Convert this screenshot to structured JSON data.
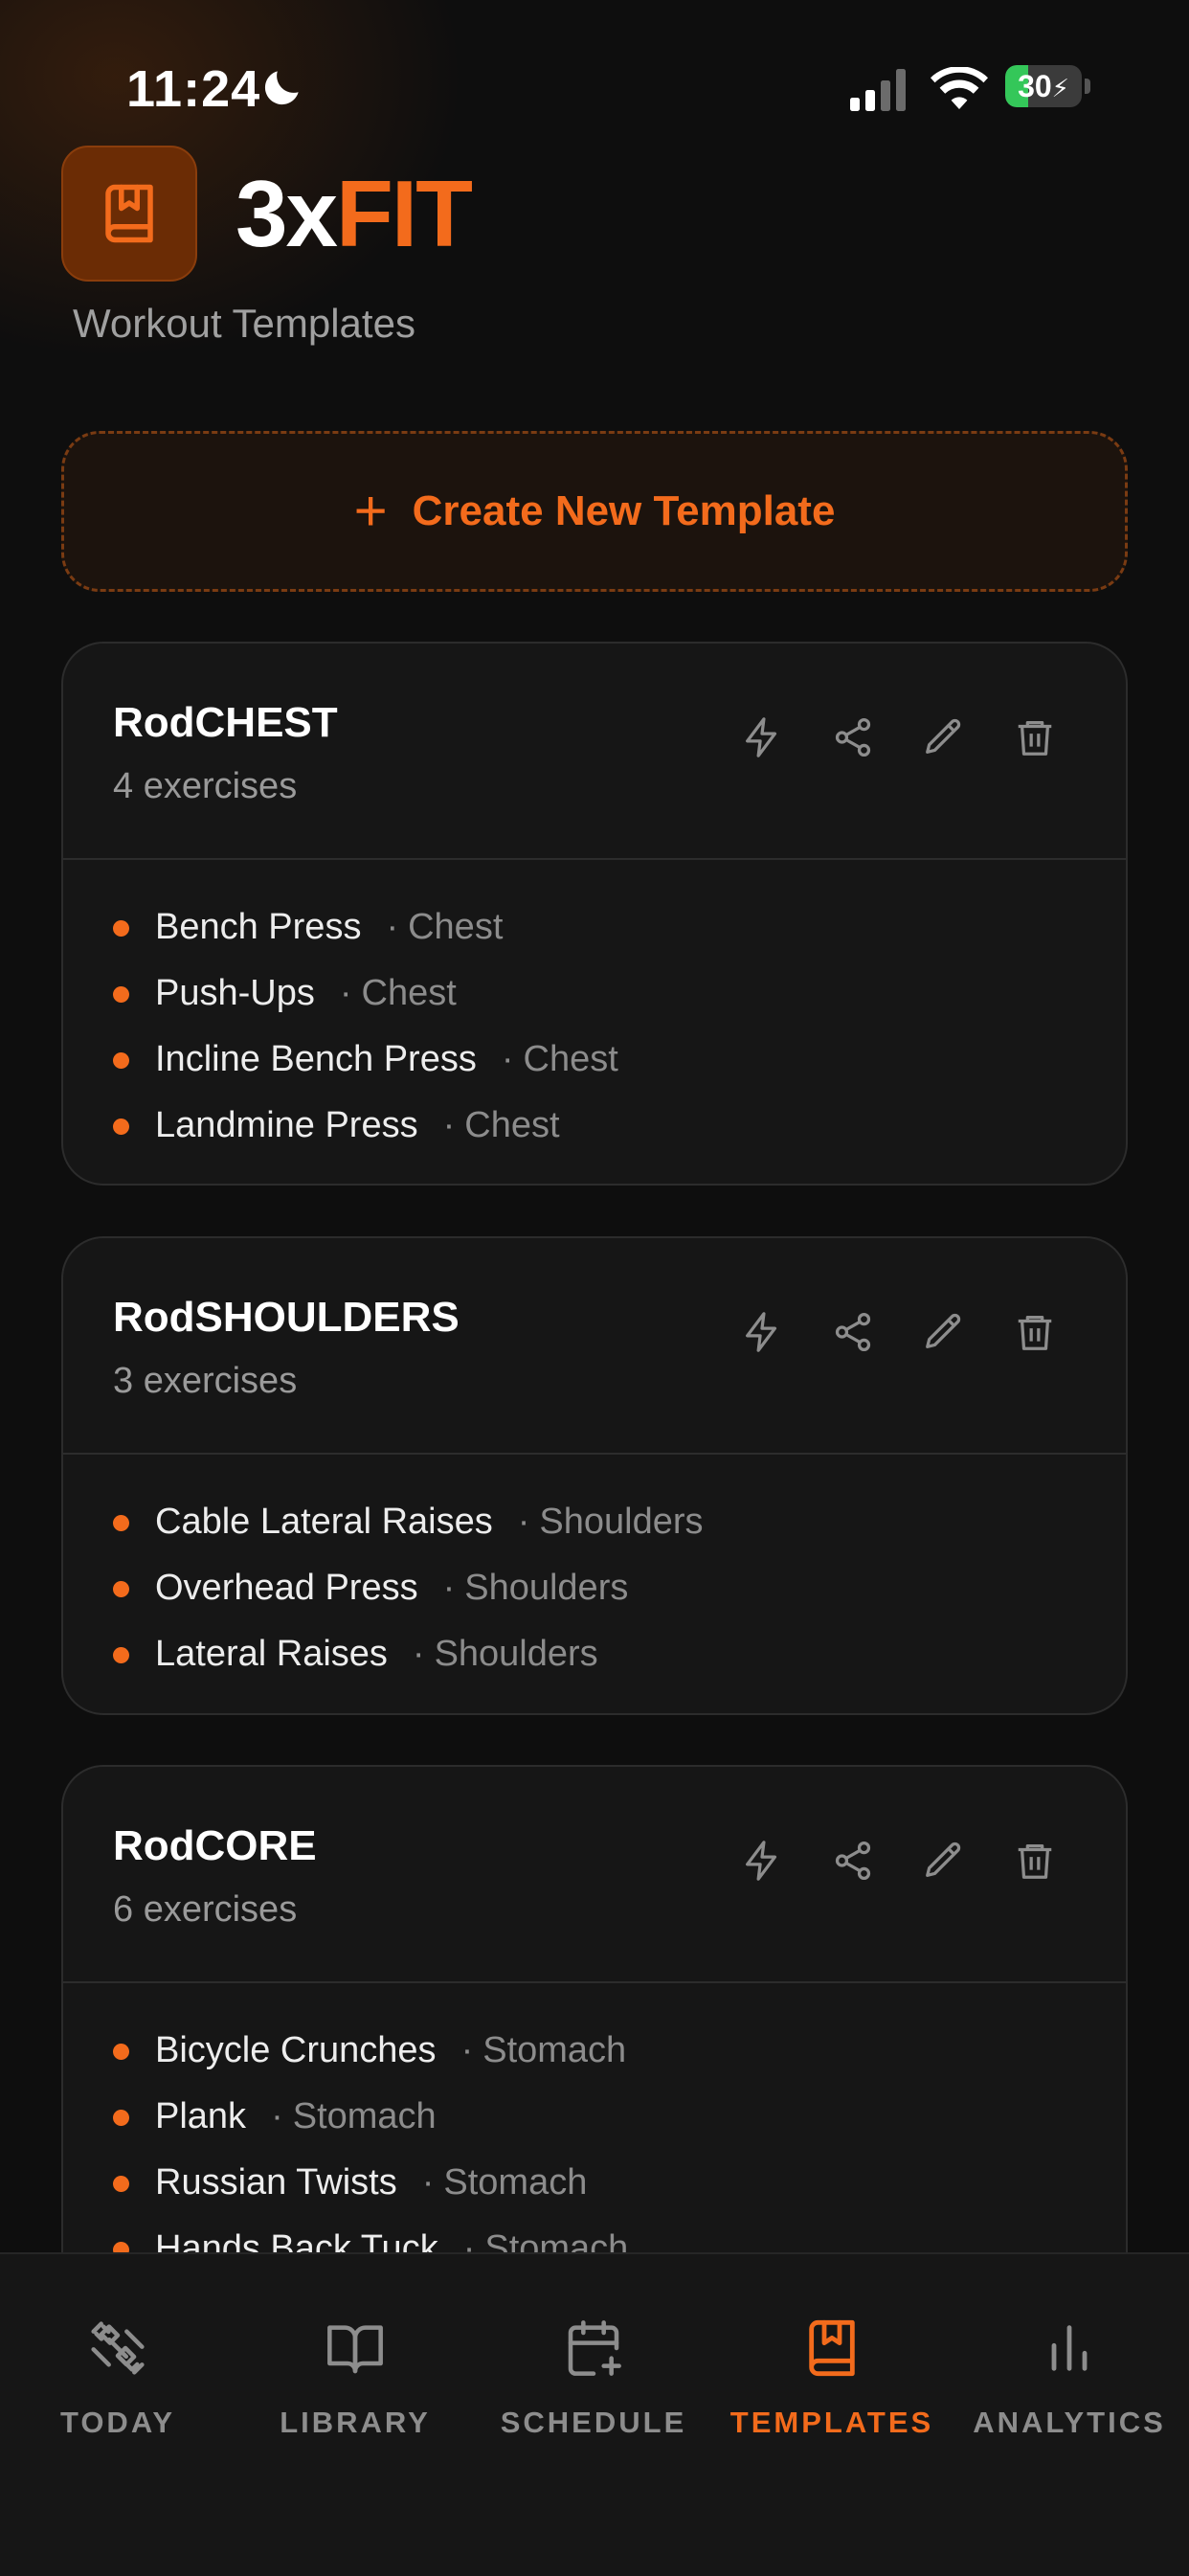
{
  "status_bar": {
    "time": "11:24",
    "battery": "30",
    "icons": [
      "moon-icon",
      "signal-icon",
      "wifi-icon",
      "battery-icon"
    ]
  },
  "header": {
    "logo_icon": "book-bookmark-icon",
    "title_part1": "3x",
    "title_part2": "FIT",
    "subtitle": "Workout Templates"
  },
  "create_button": {
    "icon": "plus-icon",
    "label": "Create New Template"
  },
  "templates": [
    {
      "name": "RodCHEST",
      "count": "4 exercises",
      "exercises": [
        {
          "name": "Bench Press",
          "category": "Chest"
        },
        {
          "name": "Push-Ups",
          "category": "Chest"
        },
        {
          "name": "Incline Bench Press",
          "category": "Chest"
        },
        {
          "name": "Landmine Press",
          "category": "Chest"
        }
      ]
    },
    {
      "name": "RodSHOULDERS",
      "count": "3 exercises",
      "exercises": [
        {
          "name": "Cable Lateral Raises",
          "category": "Shoulders"
        },
        {
          "name": "Overhead Press",
          "category": "Shoulders"
        },
        {
          "name": "Lateral Raises",
          "category": "Shoulders"
        }
      ]
    },
    {
      "name": "RodCORE",
      "count": "6 exercises",
      "exercises": [
        {
          "name": "Bicycle Crunches",
          "category": "Stomach"
        },
        {
          "name": "Plank",
          "category": "Stomach"
        },
        {
          "name": "Russian Twists",
          "category": "Stomach"
        },
        {
          "name": "Hands Back Tuck",
          "category": "Stomach"
        }
      ]
    }
  ],
  "bottom_nav": [
    {
      "label": "TODAY",
      "icon": "dumbbell-icon",
      "active": false
    },
    {
      "label": "LIBRARY",
      "icon": "open-book-icon",
      "active": false
    },
    {
      "label": "SCHEDULE",
      "icon": "calendar-plus-icon",
      "active": false
    },
    {
      "label": "TEMPLATES",
      "icon": "book-bookmark-icon",
      "active": true
    },
    {
      "label": "ANALYTICS",
      "icon": "bar-chart-icon",
      "active": false
    }
  ],
  "colors": {
    "accent": "#f36b1c",
    "background": "#0e0e0e",
    "card": "#161616",
    "muted": "#8c8c8c"
  }
}
